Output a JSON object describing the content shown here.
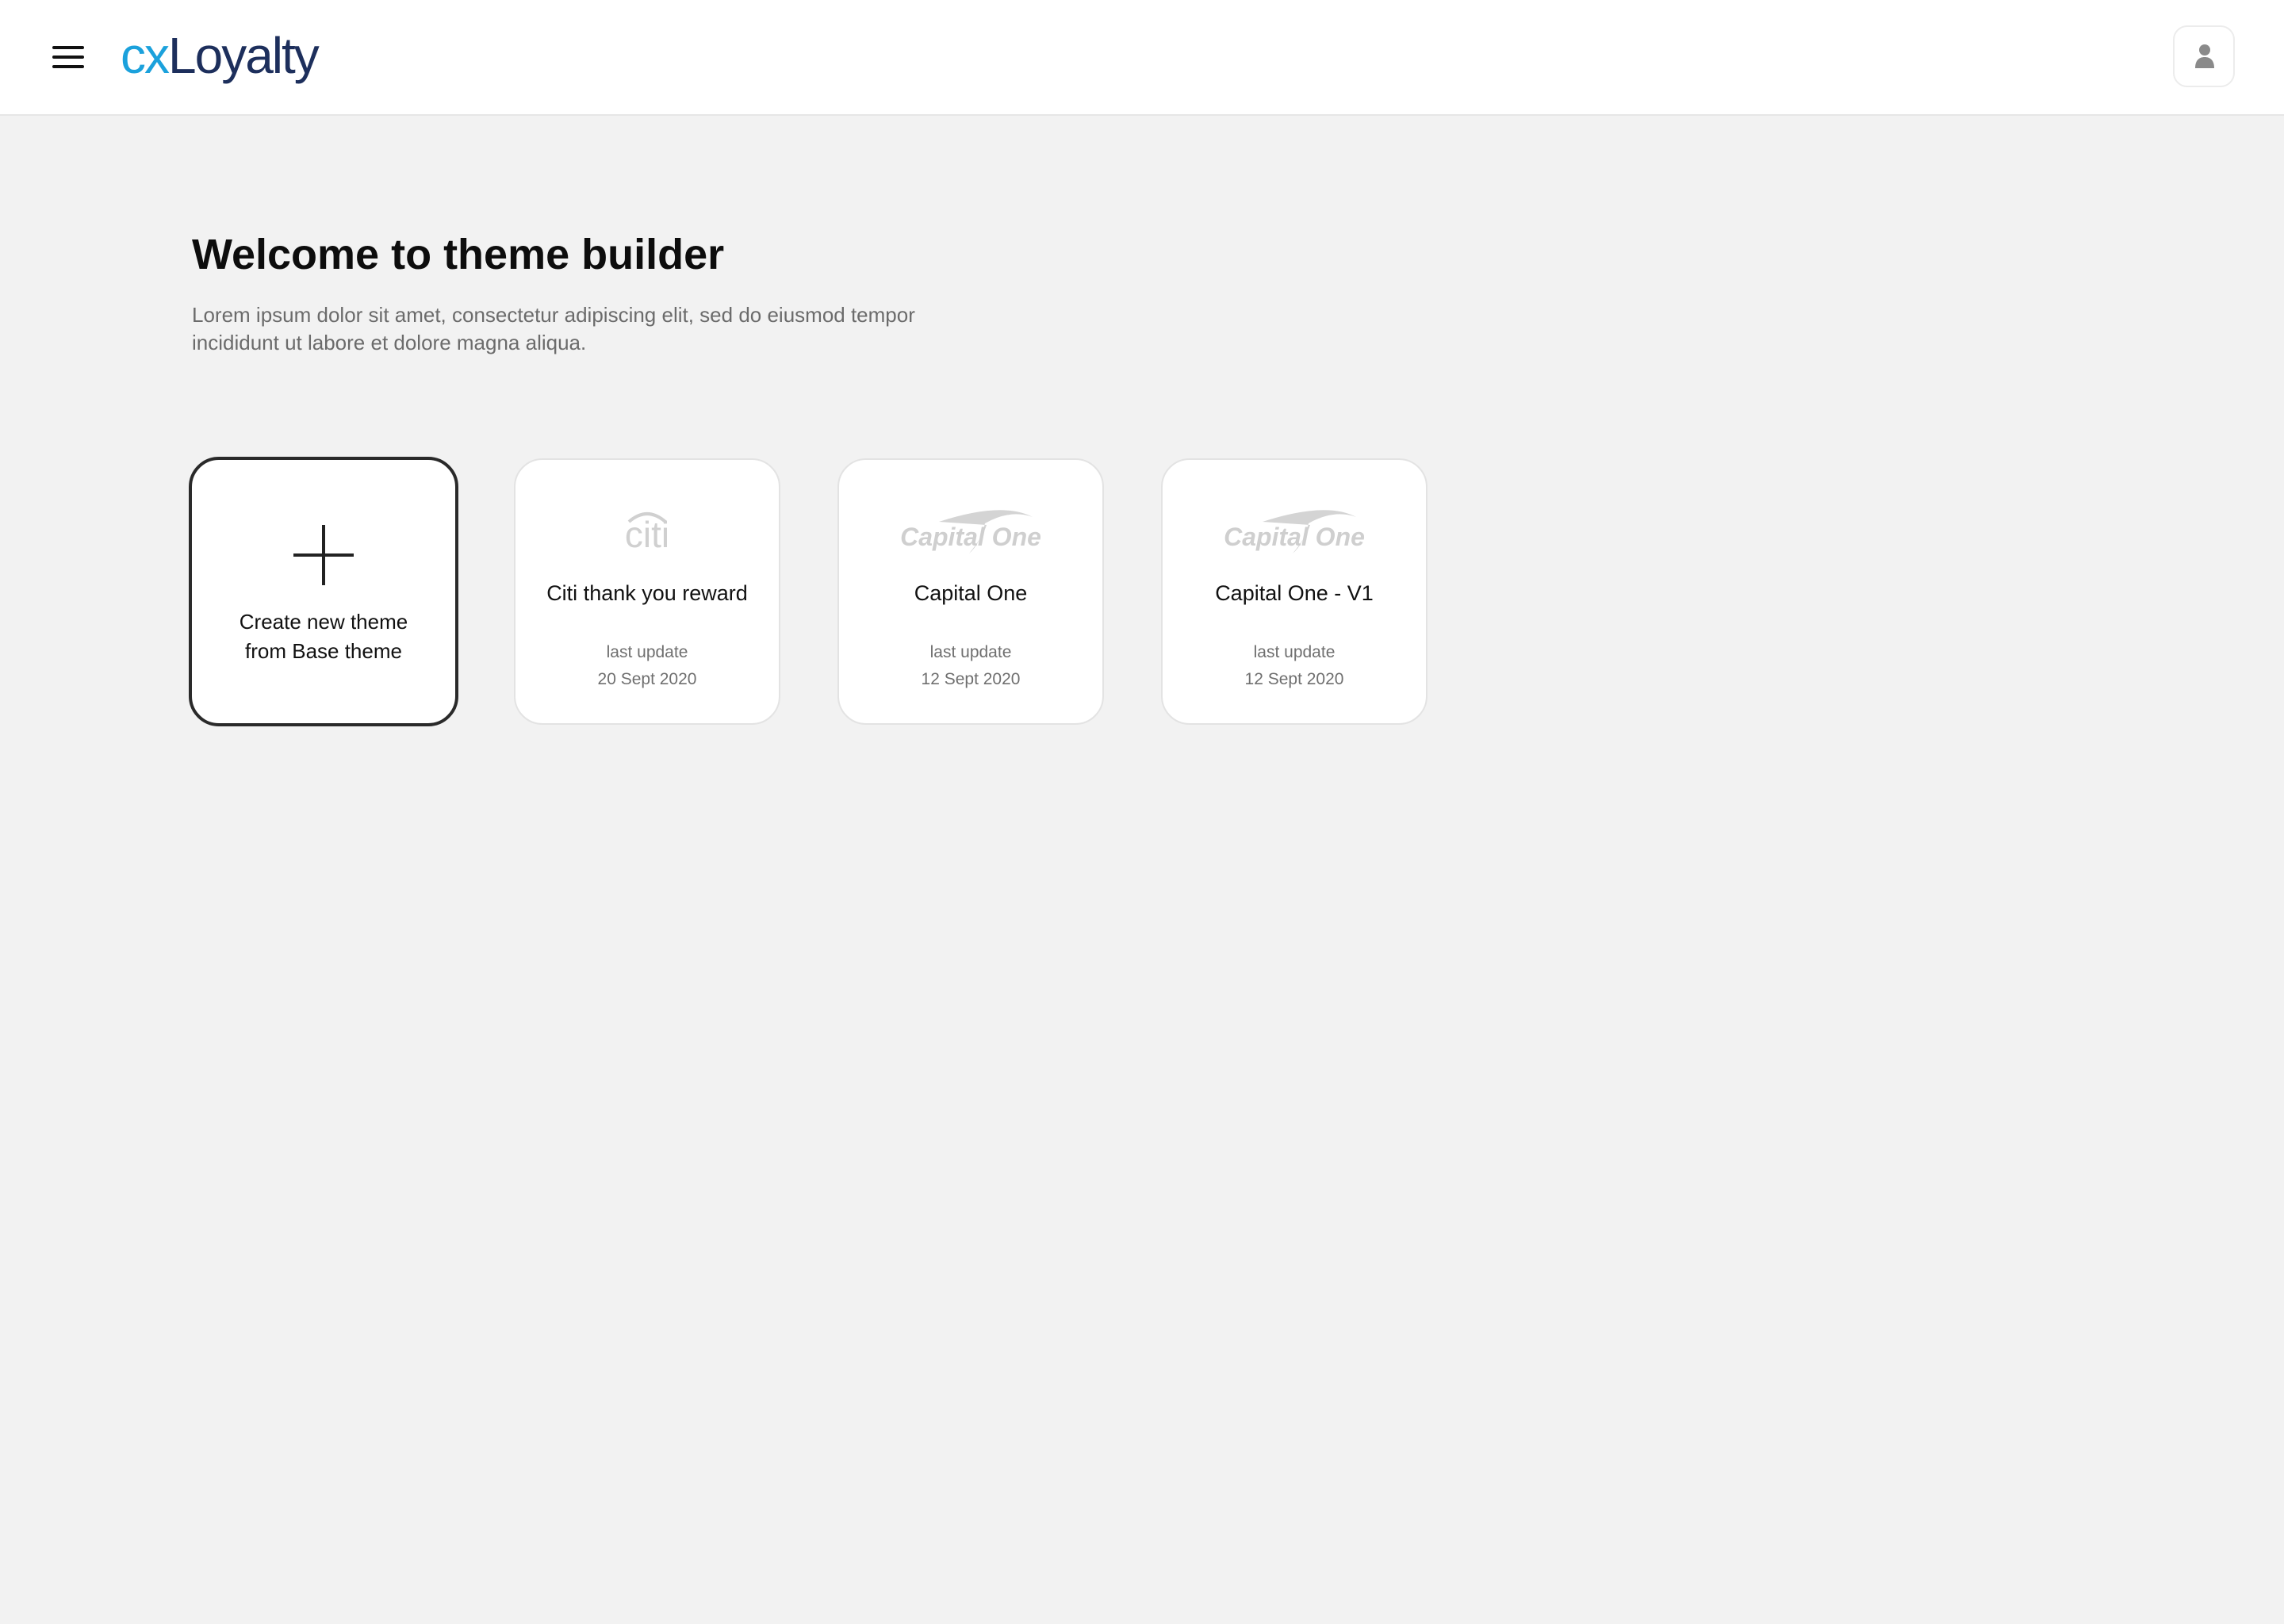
{
  "header": {
    "logo_prefix": "cx",
    "logo_name": "Loyalty",
    "menu_icon": "hamburger-menu-icon",
    "profile_icon": "user-icon"
  },
  "main": {
    "title": "Welcome to theme builder",
    "subtitle": "Lorem ipsum dolor sit amet, consectetur adipiscing elit, sed do eiusmod tempor incididunt ut labore et dolore magna aliqua."
  },
  "create_card": {
    "icon": "plus-icon",
    "line1": "Create new theme",
    "line2": "from Base theme"
  },
  "themes": [
    {
      "logo_text": "citi",
      "name": "Citi thank you reward",
      "update_label": "last update",
      "update_date": "20 Sept 2020"
    },
    {
      "logo_text": "Capital One",
      "name": "Capital One",
      "update_label": "last update",
      "update_date": "12 Sept 2020"
    },
    {
      "logo_text": "Capital One",
      "name": "Capital One - V1",
      "update_label": "last update",
      "update_date": "12 Sept 2020"
    }
  ],
  "colors": {
    "background": "#f2f2f2",
    "logo_cx": "#1ba1dc",
    "logo_loyalty": "#1d2f5c",
    "brand_logo_gray": "#cfcfcf"
  }
}
